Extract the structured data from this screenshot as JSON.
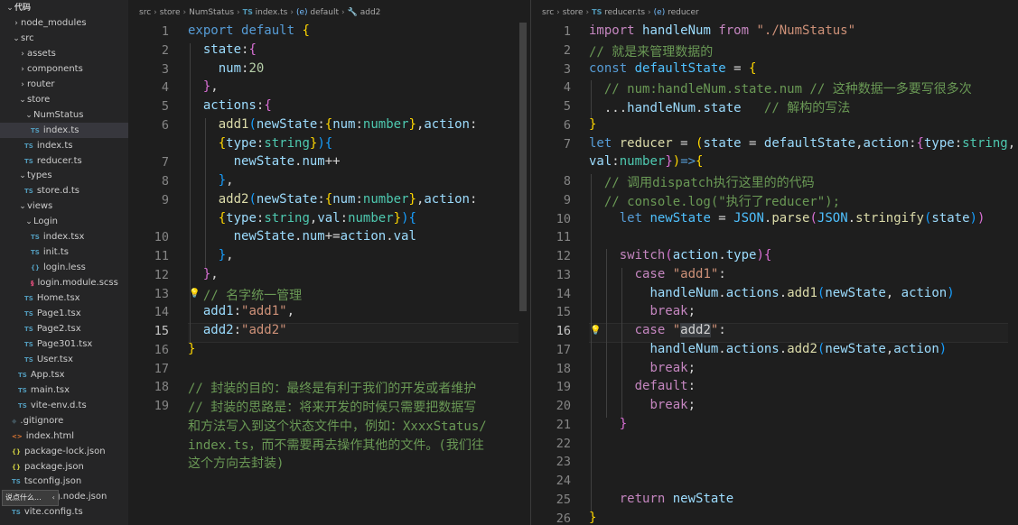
{
  "sidebar": {
    "items": [
      {
        "label": "代码",
        "depth": 0,
        "kind": "root",
        "open": true
      },
      {
        "label": "node_modules",
        "depth": 1,
        "kind": "folder",
        "open": false
      },
      {
        "label": "src",
        "depth": 1,
        "kind": "folder",
        "open": true
      },
      {
        "label": "assets",
        "depth": 2,
        "kind": "folder",
        "open": false
      },
      {
        "label": "components",
        "depth": 2,
        "kind": "folder",
        "open": false
      },
      {
        "label": "router",
        "depth": 2,
        "kind": "folder",
        "open": false
      },
      {
        "label": "store",
        "depth": 2,
        "kind": "folder",
        "open": true
      },
      {
        "label": "NumStatus",
        "depth": 3,
        "kind": "folder",
        "open": true
      },
      {
        "label": "index.ts",
        "depth": 4,
        "kind": "ts",
        "selected": true
      },
      {
        "label": "index.ts",
        "depth": 3,
        "kind": "ts"
      },
      {
        "label": "reducer.ts",
        "depth": 3,
        "kind": "ts"
      },
      {
        "label": "types",
        "depth": 2,
        "kind": "folder",
        "open": true
      },
      {
        "label": "store.d.ts",
        "depth": 3,
        "kind": "ts"
      },
      {
        "label": "views",
        "depth": 2,
        "kind": "folder",
        "open": true
      },
      {
        "label": "Login",
        "depth": 3,
        "kind": "folder",
        "open": true
      },
      {
        "label": "index.tsx",
        "depth": 4,
        "kind": "ts"
      },
      {
        "label": "init.ts",
        "depth": 4,
        "kind": "ts"
      },
      {
        "label": "login.less",
        "depth": 4,
        "kind": "css"
      },
      {
        "label": "login.module.scss",
        "depth": 4,
        "kind": "scss"
      },
      {
        "label": "Home.tsx",
        "depth": 3,
        "kind": "ts"
      },
      {
        "label": "Page1.tsx",
        "depth": 3,
        "kind": "ts"
      },
      {
        "label": "Page2.tsx",
        "depth": 3,
        "kind": "ts"
      },
      {
        "label": "Page301.tsx",
        "depth": 3,
        "kind": "ts"
      },
      {
        "label": "User.tsx",
        "depth": 3,
        "kind": "ts"
      },
      {
        "label": "App.tsx",
        "depth": 2,
        "kind": "ts"
      },
      {
        "label": "main.tsx",
        "depth": 2,
        "kind": "ts"
      },
      {
        "label": "vite-env.d.ts",
        "depth": 2,
        "kind": "ts"
      },
      {
        "label": ".gitignore",
        "depth": 1,
        "kind": "git"
      },
      {
        "label": "index.html",
        "depth": 1,
        "kind": "html"
      },
      {
        "label": "package-lock.json",
        "depth": 1,
        "kind": "json"
      },
      {
        "label": "package.json",
        "depth": 1,
        "kind": "json"
      },
      {
        "label": "tsconfig.json",
        "depth": 1,
        "kind": "ts"
      },
      {
        "label": "tsconfig.node.json",
        "depth": 1,
        "kind": "ts"
      },
      {
        "label": "vite.config.ts",
        "depth": 1,
        "kind": "ts"
      }
    ],
    "tooltip": "说点什么..."
  },
  "left": {
    "breadcrumb": [
      "src",
      "store",
      "NumStatus",
      "index.ts",
      "default",
      "add2"
    ],
    "numbers": [
      "1",
      "2",
      "3",
      "4",
      "5",
      "6",
      "",
      "7",
      "8",
      "9",
      "",
      "10",
      "11",
      "12",
      "13",
      "14",
      "15",
      "16",
      "17",
      "18",
      "19",
      "",
      "",
      ""
    ],
    "active_line": "15",
    "lines": [
      [
        [
          "kw",
          "export "
        ],
        [
          "kw",
          "default "
        ],
        [
          "br1",
          "{"
        ]
      ],
      [
        [
          "t",
          "  "
        ],
        [
          "var",
          "state"
        ],
        [
          "t",
          ":"
        ],
        [
          "br2",
          "{"
        ]
      ],
      [
        [
          "t",
          "    "
        ],
        [
          "var",
          "num"
        ],
        [
          "t",
          ":"
        ],
        [
          "num",
          "20"
        ]
      ],
      [
        [
          "t",
          "  "
        ],
        [
          "br2",
          "}"
        ],
        [
          "t",
          ","
        ]
      ],
      [
        [
          "t",
          "  "
        ],
        [
          "var",
          "actions"
        ],
        [
          "t",
          ":"
        ],
        [
          "br2",
          "{"
        ]
      ],
      [
        [
          "t",
          "    "
        ],
        [
          "fn",
          "add1"
        ],
        [
          "br3",
          "("
        ],
        [
          "var",
          "newState"
        ],
        [
          "t",
          ":"
        ],
        [
          "br1",
          "{"
        ],
        [
          "var",
          "num"
        ],
        [
          "t",
          ":"
        ],
        [
          "typ",
          "number"
        ],
        [
          "br1",
          "}"
        ],
        [
          "t",
          ","
        ],
        [
          "var",
          "action"
        ],
        [
          "t",
          ":"
        ]
      ],
      [
        [
          "t",
          "    "
        ],
        [
          "br1",
          "{"
        ],
        [
          "var",
          "type"
        ],
        [
          "t",
          ":"
        ],
        [
          "typ",
          "string"
        ],
        [
          "br1",
          "}"
        ],
        [
          "br3",
          ")"
        ],
        [
          "br3",
          "{"
        ]
      ],
      [
        [
          "t",
          "      "
        ],
        [
          "var",
          "newState"
        ],
        [
          "t",
          "."
        ],
        [
          "var",
          "num"
        ],
        [
          "t",
          "++"
        ]
      ],
      [
        [
          "t",
          "    "
        ],
        [
          "br3",
          "}"
        ],
        [
          "t",
          ","
        ]
      ],
      [
        [
          "t",
          "    "
        ],
        [
          "fn",
          "add2"
        ],
        [
          "br3",
          "("
        ],
        [
          "var",
          "newState"
        ],
        [
          "t",
          ":"
        ],
        [
          "br1",
          "{"
        ],
        [
          "var",
          "num"
        ],
        [
          "t",
          ":"
        ],
        [
          "typ",
          "number"
        ],
        [
          "br1",
          "}"
        ],
        [
          "t",
          ","
        ],
        [
          "var",
          "action"
        ],
        [
          "t",
          ":"
        ]
      ],
      [
        [
          "t",
          "    "
        ],
        [
          "br1",
          "{"
        ],
        [
          "var",
          "type"
        ],
        [
          "t",
          ":"
        ],
        [
          "typ",
          "string"
        ],
        [
          "t",
          ","
        ],
        [
          "var",
          "val"
        ],
        [
          "t",
          ":"
        ],
        [
          "typ",
          "number"
        ],
        [
          "br1",
          "}"
        ],
        [
          "br3",
          ")"
        ],
        [
          "br3",
          "{"
        ]
      ],
      [
        [
          "t",
          "      "
        ],
        [
          "var",
          "newState"
        ],
        [
          "t",
          "."
        ],
        [
          "var",
          "num"
        ],
        [
          "t",
          "+="
        ],
        [
          "var",
          "action"
        ],
        [
          "t",
          "."
        ],
        [
          "var",
          "val"
        ]
      ],
      [
        [
          "t",
          "    "
        ],
        [
          "br3",
          "}"
        ],
        [
          "t",
          ","
        ]
      ],
      [
        [
          "t",
          "  "
        ],
        [
          "br2",
          "}"
        ],
        [
          "t",
          ","
        ]
      ],
      [
        [
          "t",
          "  "
        ],
        [
          "cmt",
          "// 名字统一管理"
        ]
      ],
      [
        [
          "t",
          "  "
        ],
        [
          "var",
          "add1"
        ],
        [
          "t",
          ":"
        ],
        [
          "str",
          "\"add1\""
        ],
        [
          "t",
          ","
        ]
      ],
      [
        [
          "t",
          "  "
        ],
        [
          "var",
          "add2"
        ],
        [
          "t",
          ":"
        ],
        [
          "str",
          "\"add2\""
        ]
      ],
      [
        [
          "br1",
          "}"
        ]
      ],
      [],
      [
        [
          "cmt",
          "// 封装的目的：最终是有利于我们的开发或者维护"
        ]
      ],
      [
        [
          "cmt",
          "// 封装的思路是：将来开发的时候只需要把数据写"
        ]
      ],
      [
        [
          "cmt",
          "和方法写入到这个状态文件中，例如：XxxxStatus/"
        ]
      ],
      [
        [
          "cmt",
          "index.ts，而不需要再去操作其他的文件。(我们往"
        ]
      ],
      [
        [
          "cmt",
          "这个方向去封装)"
        ]
      ]
    ]
  },
  "right": {
    "breadcrumb": [
      "src",
      "store",
      "reducer.ts",
      "reducer"
    ],
    "numbers": [
      "1",
      "2",
      "3",
      "4",
      "5",
      "6",
      "7",
      "",
      "8",
      "9",
      "10",
      "11",
      "12",
      "13",
      "14",
      "15",
      "16",
      "17",
      "18",
      "19",
      "20",
      "21",
      "22",
      "23",
      "24",
      "25",
      "26"
    ],
    "active_line": "16",
    "lines": [
      [
        [
          "kwc",
          "import "
        ],
        [
          "var",
          "handleNum "
        ],
        [
          "kwc",
          "from "
        ],
        [
          "str",
          "\"./NumStatus\""
        ]
      ],
      [
        [
          "cmt",
          "// 就是来管理数据的"
        ]
      ],
      [
        [
          "kw",
          "const "
        ],
        [
          "cst",
          "defaultState"
        ],
        [
          "t",
          " = "
        ],
        [
          "br1",
          "{"
        ]
      ],
      [
        [
          "t",
          "  "
        ],
        [
          "cmt",
          "// num:handleNum.state.num // 这种数据一多要写很多次"
        ]
      ],
      [
        [
          "t",
          "  ..."
        ],
        [
          "var",
          "handleNum"
        ],
        [
          "t",
          "."
        ],
        [
          "var",
          "state"
        ],
        [
          "t",
          "   "
        ],
        [
          "cmt",
          "// 解构的写法"
        ]
      ],
      [
        [
          "br1",
          "}"
        ]
      ],
      [
        [
          "kw",
          "let "
        ],
        [
          "fn",
          "reducer"
        ],
        [
          "t",
          " = "
        ],
        [
          "br1",
          "("
        ],
        [
          "var",
          "state"
        ],
        [
          "t",
          " = "
        ],
        [
          "var",
          "defaultState"
        ],
        [
          "t",
          ","
        ],
        [
          "var",
          "action"
        ],
        [
          "t",
          ":"
        ],
        [
          "br2",
          "{"
        ],
        [
          "var",
          "type"
        ],
        [
          "t",
          ":"
        ],
        [
          "typ",
          "string"
        ],
        [
          "t",
          ","
        ]
      ],
      [
        [
          "var",
          "val"
        ],
        [
          "t",
          ":"
        ],
        [
          "typ",
          "number"
        ],
        [
          "br2",
          "}"
        ],
        [
          "br1",
          ")"
        ],
        [
          "kw",
          "=>"
        ],
        [
          "br1",
          "{"
        ]
      ],
      [
        [
          "t",
          "  "
        ],
        [
          "cmt",
          "// 调用dispatch执行这里的的代码"
        ]
      ],
      [
        [
          "t",
          "  "
        ],
        [
          "cmt",
          "// console.log(\"执行了reducer\");"
        ]
      ],
      [
        [
          "t",
          "    "
        ],
        [
          "kw",
          "let "
        ],
        [
          "cst",
          "newState"
        ],
        [
          "t",
          " = "
        ],
        [
          "cst",
          "JSON"
        ],
        [
          "t",
          "."
        ],
        [
          "fn",
          "parse"
        ],
        [
          "br2",
          "("
        ],
        [
          "cst",
          "JSON"
        ],
        [
          "t",
          "."
        ],
        [
          "fn",
          "stringify"
        ],
        [
          "br3",
          "("
        ],
        [
          "var",
          "state"
        ],
        [
          "br3",
          ")"
        ],
        [
          "br2",
          ")"
        ]
      ],
      [],
      [
        [
          "t",
          "    "
        ],
        [
          "kwc",
          "switch"
        ],
        [
          "br2",
          "("
        ],
        [
          "var",
          "action"
        ],
        [
          "t",
          "."
        ],
        [
          "var",
          "type"
        ],
        [
          "br2",
          ")"
        ],
        [
          "br2",
          "{"
        ]
      ],
      [
        [
          "t",
          "      "
        ],
        [
          "kwc",
          "case "
        ],
        [
          "str",
          "\"add1\""
        ],
        [
          "t",
          ":"
        ]
      ],
      [
        [
          "t",
          "        "
        ],
        [
          "var",
          "handleNum"
        ],
        [
          "t",
          "."
        ],
        [
          "var",
          "actions"
        ],
        [
          "t",
          "."
        ],
        [
          "fn",
          "add1"
        ],
        [
          "br3",
          "("
        ],
        [
          "var",
          "newState"
        ],
        [
          "t",
          ", "
        ],
        [
          "var",
          "action"
        ],
        [
          "br3",
          ")"
        ]
      ],
      [
        [
          "t",
          "        "
        ],
        [
          "kwc",
          "break"
        ],
        [
          "t",
          ";"
        ]
      ],
      [
        [
          "t",
          "      "
        ],
        [
          "kwc",
          "case "
        ],
        [
          "str",
          "\""
        ],
        [
          "sel",
          "add2"
        ],
        [
          "str",
          "\""
        ],
        [
          "t",
          ":"
        ]
      ],
      [
        [
          "t",
          "        "
        ],
        [
          "var",
          "handleNum"
        ],
        [
          "t",
          "."
        ],
        [
          "var",
          "actions"
        ],
        [
          "t",
          "."
        ],
        [
          "fn",
          "add2"
        ],
        [
          "br3",
          "("
        ],
        [
          "var",
          "newState"
        ],
        [
          "t",
          ","
        ],
        [
          "var",
          "action"
        ],
        [
          "br3",
          ")"
        ]
      ],
      [
        [
          "t",
          "        "
        ],
        [
          "kwc",
          "break"
        ],
        [
          "t",
          ";"
        ]
      ],
      [
        [
          "t",
          "      "
        ],
        [
          "kwc",
          "default"
        ],
        [
          "t",
          ":"
        ]
      ],
      [
        [
          "t",
          "        "
        ],
        [
          "kwc",
          "break"
        ],
        [
          "t",
          ";"
        ]
      ],
      [
        [
          "t",
          "    "
        ],
        [
          "br2",
          "}"
        ]
      ],
      [],
      [],
      [],
      [
        [
          "t",
          "    "
        ],
        [
          "kwc",
          "return "
        ],
        [
          "var",
          "newState"
        ]
      ],
      [
        [
          "br1",
          "}"
        ]
      ]
    ]
  }
}
